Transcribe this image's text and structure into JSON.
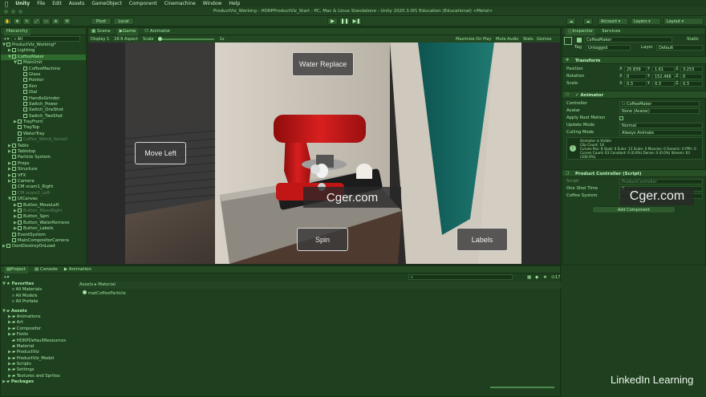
{
  "menubar": {
    "app": "Unity",
    "items": [
      "File",
      "Edit",
      "Assets",
      "GameObject",
      "Component",
      "Cinemachine",
      "Window",
      "Help"
    ]
  },
  "window_title": "ProductViz_Working - HDRPProductViz_Start - PC, Mac & Linux Standalone - Unity 2020.3.0f1 Education (Educational) <Metal>",
  "toolbar": {
    "account": "Account",
    "layers": "Layers",
    "layout": "Layout"
  },
  "hierarchy": {
    "tab": "Hierarchy",
    "search_placeholder": "All",
    "items": [
      {
        "label": "ProductViz_Working*",
        "depth": 0,
        "arrow": "▼",
        "type": "scene"
      },
      {
        "label": "Lighting",
        "depth": 1,
        "arrow": "▶"
      },
      {
        "label": "CoffeeMaker",
        "depth": 1,
        "arrow": "▼",
        "selected": true
      },
      {
        "label": "MainUnit",
        "depth": 2,
        "arrow": "▼"
      },
      {
        "label": "CoffeeMachine",
        "depth": 3,
        "arrow": ""
      },
      {
        "label": "Glass",
        "depth": 3,
        "arrow": ""
      },
      {
        "label": "Pointer",
        "depth": 3,
        "arrow": ""
      },
      {
        "label": "Rim",
        "depth": 3,
        "arrow": ""
      },
      {
        "label": "Dial",
        "depth": 3,
        "arrow": ""
      },
      {
        "label": "HandleGrinder",
        "depth": 3,
        "arrow": ""
      },
      {
        "label": "Switch_Power",
        "depth": 3,
        "arrow": ""
      },
      {
        "label": "Switch_OneShot",
        "depth": 3,
        "arrow": ""
      },
      {
        "label": "Switch_TwoShot",
        "depth": 3,
        "arrow": ""
      },
      {
        "label": "TrayFront",
        "depth": 2,
        "arrow": "▶"
      },
      {
        "label": "TrayTop",
        "depth": 2,
        "arrow": ""
      },
      {
        "label": "WaterTray",
        "depth": 2,
        "arrow": ""
      },
      {
        "label": "Coffee_World_Socket",
        "depth": 2,
        "arrow": "",
        "dim": true
      },
      {
        "label": "Table",
        "depth": 1,
        "arrow": "▶"
      },
      {
        "label": "Tabletop",
        "depth": 1,
        "arrow": "▶"
      },
      {
        "label": "Particle System",
        "depth": 1,
        "arrow": ""
      },
      {
        "label": "Props",
        "depth": 1,
        "arrow": "▶"
      },
      {
        "label": "Structure",
        "depth": 1,
        "arrow": "▶"
      },
      {
        "label": "VFX",
        "depth": 1,
        "arrow": "▶"
      },
      {
        "label": "Camera",
        "depth": 1,
        "arrow": "▶"
      },
      {
        "label": "CM vcam1_Right",
        "depth": 1,
        "arrow": ""
      },
      {
        "label": "CM vcam2_Left",
        "depth": 1,
        "arrow": "",
        "dim": true
      },
      {
        "label": "UICanvas",
        "depth": 1,
        "arrow": "▼"
      },
      {
        "label": "Button_MoveLeft",
        "depth": 2,
        "arrow": "▶"
      },
      {
        "label": "Button_MoveRight",
        "depth": 2,
        "arrow": "▶",
        "dim": true
      },
      {
        "label": "Button_Spin",
        "depth": 2,
        "arrow": "▶"
      },
      {
        "label": "Button_WaterRemove",
        "depth": 2,
        "arrow": "▶"
      },
      {
        "label": "Button_Labels",
        "depth": 2,
        "arrow": "▶"
      },
      {
        "label": "EventSystem",
        "depth": 1,
        "arrow": ""
      },
      {
        "label": "MainCompositorCamera",
        "depth": 1,
        "arrow": ""
      },
      {
        "label": "DontDestroyOnLoad",
        "depth": 0,
        "arrow": "▶",
        "type": "scene"
      }
    ]
  },
  "scene_tabs": [
    "Pivot",
    "Local"
  ],
  "view_tabs": [
    "Scene",
    "Game",
    "Animator"
  ],
  "game_bar": {
    "display": "Display 1",
    "aspect": "16:9 Aspect",
    "scale_label": "Scale",
    "scale_value": "1x",
    "maximize": "Maximize On Play",
    "mute": "Mute Audio",
    "stats": "Stats",
    "gizmos": "Gizmos"
  },
  "game_buttons": {
    "water": "Water Replace",
    "move_left": "Move Left",
    "spin": "Spin",
    "labels": "Labels"
  },
  "watermark": "Cger.com",
  "inspector": {
    "tabs": [
      "Inspector",
      "Services"
    ],
    "object_name": "CoffeeMaker",
    "static": "Static",
    "tag_label": "Tag",
    "tag": "Untagged",
    "layer_label": "Layer",
    "layer": "Default",
    "transform": {
      "title": "Transform",
      "position_label": "Position",
      "pos": [
        "25.839",
        "1.61",
        "3.253"
      ],
      "rotation_label": "Rotation",
      "rot": [
        "0",
        "152.466",
        "0"
      ],
      "scale_label": "Scale",
      "scale": [
        "0.3",
        "0.3",
        "0.3"
      ]
    },
    "animator": {
      "title": "Animator",
      "controller_label": "Controller",
      "controller": "CoffeeMaker",
      "avatar_label": "Avatar",
      "avatar": "None (Avatar)",
      "root_motion_label": "Apply Root Motion",
      "update_label": "Update Mode",
      "update": "Normal",
      "culling_label": "Culling Mode",
      "culling": "Always Animate",
      "info": [
        "Animator is Visible",
        "Clip Count: 18",
        "Curves Pos: 8 Quat: 0 Euler: 13 Scale: 0 Muscles: 0 Generic: 0 PPtr: 0",
        "Curves Count: 63 Constant: 0 (0.0%) Dense: 0 (0.0%) Stream: 63",
        "(100.0%)"
      ]
    },
    "script": {
      "title": "Product Controller (Script)",
      "script_label": "Script",
      "script": "ProductController",
      "one_shot_label": "One Shot Time",
      "one_shot": "2",
      "coffee_label": "Coffee System"
    },
    "add_component": "Add Component"
  },
  "bottom": {
    "tabs": [
      "Project",
      "Console",
      "Animation"
    ],
    "favorites": "Favorites",
    "fav_items": [
      "All Materials",
      "All Models",
      "All Prefabs"
    ],
    "assets": "Assets",
    "asset_items": [
      "Animations",
      "Art",
      "Compositor",
      "Fonts",
      "HDRPDefaultResources",
      "Material",
      "ProductViz",
      "ProductViz_Model",
      "Scripts",
      "Settings",
      "Textures and Sprites"
    ],
    "packages": "Packages",
    "breadcrumb": [
      "Assets",
      "Material"
    ],
    "files": [
      "matCoffeeParticle"
    ],
    "count": "17"
  },
  "brand": "LinkedIn Learning"
}
